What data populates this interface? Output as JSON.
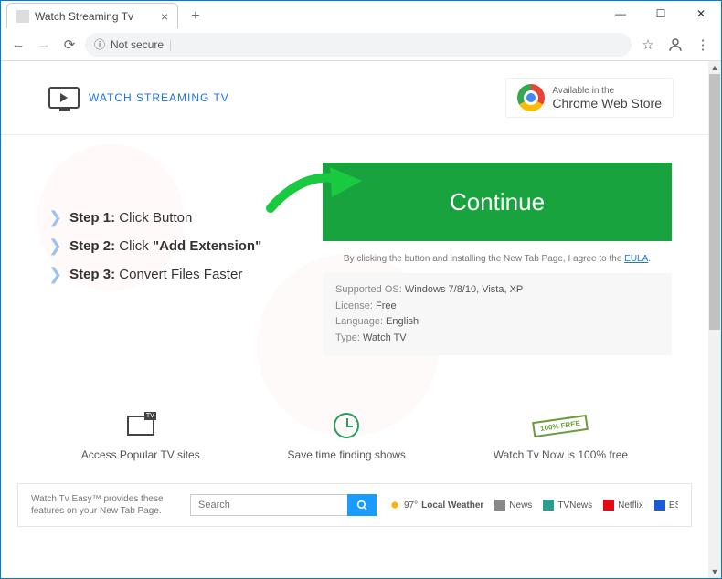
{
  "tab": {
    "title": "Watch Streaming Tv"
  },
  "toolbar": {
    "not_secure": "Not secure"
  },
  "header": {
    "logo_text": "WATCH STREAMING TV",
    "cws_small": "Available in the",
    "cws_big": "Chrome Web Store"
  },
  "steps": {
    "s1_label": "Step 1:",
    "s1_text": " Click Button",
    "s2_label": "Step 2:",
    "s2_text": " Click ",
    "s2_quoted": "\"Add Extension\"",
    "s3_label": "Step 3:",
    "s3_text": " Convert Files Faster"
  },
  "cta": {
    "continue": "Continue",
    "agree_prefix": "By clicking the button and installing the New Tab Page, I agree to the ",
    "agree_link": "EULA",
    "agree_suffix": "."
  },
  "meta": {
    "os_label": "Supported OS:",
    "os_val": " Windows 7/8/10, Vista, XP",
    "lic_label": "License:",
    "lic_val": " Free",
    "lang_label": "Language:",
    "lang_val": " English",
    "type_label": "Type:",
    "type_val": " Watch TV"
  },
  "features": {
    "f1": "Access Popular TV sites",
    "f2": "Save time finding shows",
    "f3": "Watch Tv Now is 100% free",
    "badge": "100% FREE"
  },
  "footer": {
    "tagline": "Watch Tv Easy™ provides these features on your New Tab Page.",
    "search_placeholder": "Search",
    "links": {
      "weather_temp": "97°",
      "weather": " Local Weather",
      "news": "News",
      "tvnews": "TVNews",
      "netflix": "Netflix",
      "espn": "ESPN GO"
    }
  }
}
